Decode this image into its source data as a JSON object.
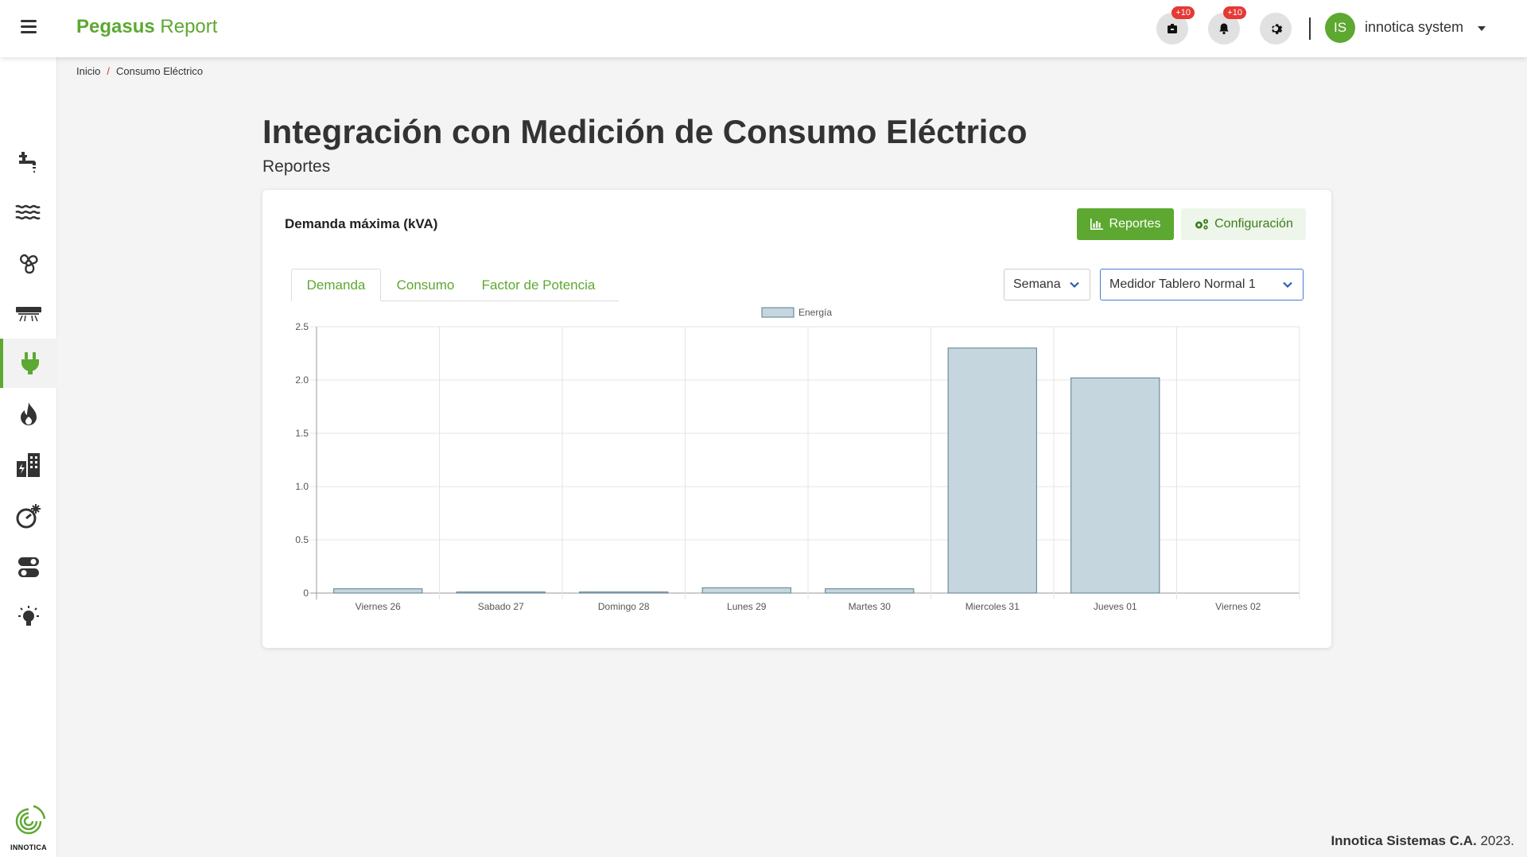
{
  "app": {
    "brand_bold": "Pegasus",
    "brand_rest": "Report"
  },
  "header": {
    "notifications_badge_1": "+10",
    "notifications_badge_2": "+10",
    "avatar_initials": "IS",
    "user_name": "innotica system"
  },
  "breadcrumb": {
    "home": "Inicio",
    "current": "Consumo Eléctrico"
  },
  "page": {
    "title": "Integración con Medición de Consumo Eléctrico",
    "subtitle": "Reportes"
  },
  "card": {
    "title": "Demanda máxima (kVA)",
    "reports_button": "Reportes",
    "config_button": "Configuración",
    "tabs": [
      {
        "label": "Demanda"
      },
      {
        "label": "Consumo"
      },
      {
        "label": "Factor de Potencia"
      }
    ],
    "period_select": "Semana",
    "meter_select": "Medidor Tablero Normal 1"
  },
  "sidebar": {
    "items": [
      "water-tap-icon",
      "waves-icon",
      "wind-icon",
      "air-conditioner-icon",
      "plug-icon",
      "flame-icon",
      "building-energy-icon",
      "climate-icon",
      "toggle-icon",
      "light-bulb-icon"
    ],
    "logo_text": "INNOTICA"
  },
  "footer": {
    "bold": "Innotica Sistemas C.A.",
    "year": "2023."
  },
  "colors": {
    "accent": "#5da831",
    "bar_fill": "#c5d6df",
    "bar_stroke": "#5b7c8d"
  },
  "chart_data": {
    "type": "bar",
    "categories": [
      "Viernes 26",
      "Sabado 27",
      "Domingo 28",
      "Lunes 29",
      "Martes 30",
      "Miercoles 31",
      "Jueves 01",
      "Viernes 02"
    ],
    "series": [
      {
        "name": "Energía",
        "values": [
          0.04,
          0.01,
          0.01,
          0.05,
          0.04,
          2.3,
          2.02,
          0
        ]
      }
    ],
    "ylim": [
      0,
      2.5
    ],
    "yticks": [
      "0",
      "0.5",
      "1.0",
      "1.5",
      "2.0",
      "2.5"
    ],
    "legend": "top-center",
    "grid": true
  }
}
